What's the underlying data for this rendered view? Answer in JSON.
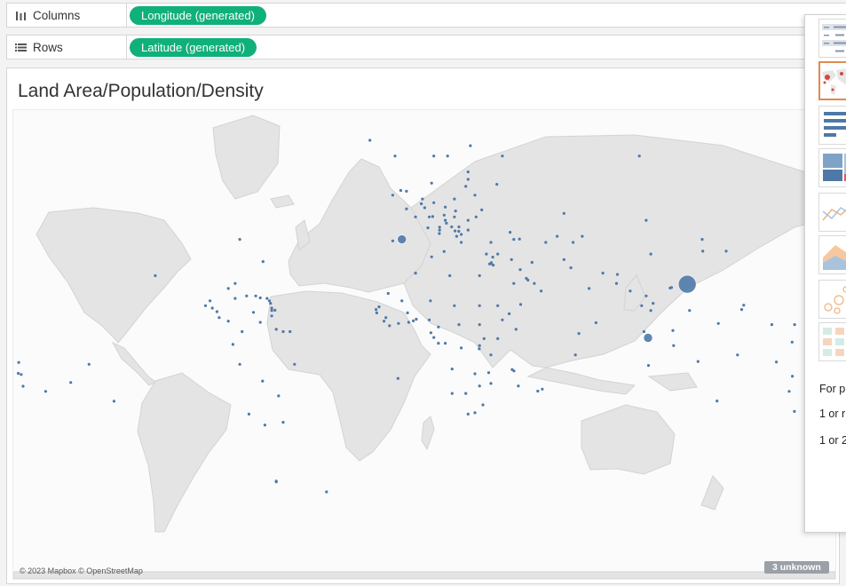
{
  "shelves": {
    "columns": {
      "label": "Columns",
      "icon": "columns-icon",
      "pill": "Longitude (generated)"
    },
    "rows": {
      "label": "Rows",
      "icon": "rows-icon",
      "pill": "Latitude (generated)"
    }
  },
  "view": {
    "title": "Land Area/Population/Density",
    "attribution": "© 2023 Mapbox © OpenStreetMap",
    "unknown_badge": "3 unknown"
  },
  "show_me": {
    "chart_types": [
      "text-table-icon",
      "symbol-map-icon",
      "bar-chart-icon",
      "treemap-icon",
      "line-chart-icon",
      "area-chart-icon",
      "scatter-plot-icon",
      "highlight-table-icon"
    ],
    "selected": "symbol-map-icon",
    "hint_line1": "For p",
    "hint_line2": "1 or r",
    "hint_line3": "1 or 2"
  },
  "colors": {
    "pill": "#10b07a",
    "mark": "#4e79a7",
    "land": "#e4e4e4",
    "selected_border": "#e0894e"
  },
  "chart_data": {
    "type": "scatter",
    "marks": [
      {
        "lon": -141,
        "lat": -10
      },
      {
        "lon": -112,
        "lat": 27
      },
      {
        "lon": -75,
        "lat": 40
      },
      {
        "lon": -64.8,
        "lat": 32.3
      },
      {
        "lon": -68,
        "lat": 19
      },
      {
        "lon": -66,
        "lat": 18.2
      },
      {
        "lon": -63,
        "lat": 18
      },
      {
        "lon": -62,
        "lat": 17
      },
      {
        "lon": -61.5,
        "lat": 16
      },
      {
        "lon": -61,
        "lat": 14
      },
      {
        "lon": -61,
        "lat": 13
      },
      {
        "lon": -59.6,
        "lat": 13.1
      },
      {
        "lon": -61,
        "lat": 10.7
      },
      {
        "lon": -69,
        "lat": 12.2
      },
      {
        "lon": -77,
        "lat": 18
      },
      {
        "lon": -80,
        "lat": 22
      },
      {
        "lon": -72,
        "lat": 19
      },
      {
        "lon": -77,
        "lat": 24
      },
      {
        "lon": -88,
        "lat": 17
      },
      {
        "lon": -90,
        "lat": 15
      },
      {
        "lon": -87,
        "lat": 14
      },
      {
        "lon": -85,
        "lat": 12.5
      },
      {
        "lon": -84,
        "lat": 10
      },
      {
        "lon": -80,
        "lat": 8.5
      },
      {
        "lon": -74,
        "lat": 4
      },
      {
        "lon": -66,
        "lat": 8
      },
      {
        "lon": -59,
        "lat": 5
      },
      {
        "lon": -56,
        "lat": 4
      },
      {
        "lon": -53,
        "lat": 4
      },
      {
        "lon": -78,
        "lat": -1.5
      },
      {
        "lon": -75,
        "lat": -10
      },
      {
        "lon": -65,
        "lat": -17
      },
      {
        "lon": -51,
        "lat": -10
      },
      {
        "lon": -58,
        "lat": -23
      },
      {
        "lon": -56,
        "lat": -33
      },
      {
        "lon": -71,
        "lat": -30
      },
      {
        "lon": -64,
        "lat": -34
      },
      {
        "lon": -59,
        "lat": -51.7
      },
      {
        "lon": -37,
        "lat": -54.3
      },
      {
        "lon": -5.7,
        "lat": -15.9
      },
      {
        "lon": -42,
        "lat": 72
      },
      {
        "lon": -18,
        "lat": 65
      },
      {
        "lon": -7,
        "lat": 62
      },
      {
        "lon": -8,
        "lat": 53
      },
      {
        "lon": -2,
        "lat": 54
      },
      {
        "lon": -2,
        "lat": 49.3
      },
      {
        "lon": -4.5,
        "lat": 54.2
      },
      {
        "lon": 2,
        "lat": 47
      },
      {
        "lon": -8,
        "lat": 39.5
      },
      {
        "lon": -4,
        "lat": 40,
        "size": "m"
      },
      {
        "lon": 5,
        "lat": 52
      },
      {
        "lon": 4.5,
        "lat": 50.7
      },
      {
        "lon": 6,
        "lat": 49.6
      },
      {
        "lon": 10,
        "lat": 51
      },
      {
        "lon": 8,
        "lat": 47
      },
      {
        "lon": 9.5,
        "lat": 47.1
      },
      {
        "lon": 7.4,
        "lat": 43.7
      },
      {
        "lon": 12.5,
        "lat": 43.9
      },
      {
        "lon": 12.4,
        "lat": 41.9
      },
      {
        "lon": 14.5,
        "lat": 35.9
      },
      {
        "lon": 14.5,
        "lat": 47.5
      },
      {
        "lon": 12.5,
        "lat": 43
      },
      {
        "lon": 9,
        "lat": 56
      },
      {
        "lon": 10,
        "lat": 62
      },
      {
        "lon": 16,
        "lat": 62
      },
      {
        "lon": 26,
        "lat": 64
      },
      {
        "lon": 25,
        "lat": 58.6
      },
      {
        "lon": 25,
        "lat": 56.9
      },
      {
        "lon": 24,
        "lat": 55.2
      },
      {
        "lon": 19,
        "lat": 52
      },
      {
        "lon": 15,
        "lat": 49.8
      },
      {
        "lon": 19.5,
        "lat": 48.7
      },
      {
        "lon": 19,
        "lat": 47
      },
      {
        "lon": 15,
        "lat": 46
      },
      {
        "lon": 15.5,
        "lat": 45.1
      },
      {
        "lon": 21,
        "lat": 44
      },
      {
        "lon": 17.8,
        "lat": 44
      },
      {
        "lon": 19.3,
        "lat": 42.7
      },
      {
        "lon": 20.9,
        "lat": 42.6
      },
      {
        "lon": 22,
        "lat": 41.6
      },
      {
        "lon": 20,
        "lat": 41
      },
      {
        "lon": 22,
        "lat": 39
      },
      {
        "lon": 25,
        "lat": 43
      },
      {
        "lon": 25,
        "lat": 46
      },
      {
        "lon": 28.5,
        "lat": 47
      },
      {
        "lon": 31,
        "lat": 49
      },
      {
        "lon": 28,
        "lat": 53
      },
      {
        "lon": 37.6,
        "lat": 55.7
      },
      {
        "lon": 40,
        "lat": 62
      },
      {
        "lon": 100,
        "lat": 62
      },
      {
        "lon": 18,
        "lat": 79
      },
      {
        "lon": -8.5,
        "lat": 71
      },
      {
        "lon": 33,
        "lat": 35
      },
      {
        "lon": 35,
        "lat": 39
      },
      {
        "lon": 38,
        "lat": 35
      },
      {
        "lon": 35.8,
        "lat": 33.9
      },
      {
        "lon": 35,
        "lat": 31.5
      },
      {
        "lon": 34.4,
        "lat": 31.4
      },
      {
        "lon": 35.2,
        "lat": 31.9
      },
      {
        "lon": 36,
        "lat": 31
      },
      {
        "lon": 44,
        "lat": 33
      },
      {
        "lon": 45,
        "lat": 40
      },
      {
        "lon": 43.4,
        "lat": 42.3
      },
      {
        "lon": 47.5,
        "lat": 40.1
      },
      {
        "lon": 53,
        "lat": 32
      },
      {
        "lon": 45,
        "lat": 24
      },
      {
        "lon": 47.8,
        "lat": 29.3
      },
      {
        "lon": 50.5,
        "lat": 26
      },
      {
        "lon": 51.2,
        "lat": 25.3
      },
      {
        "lon": 54,
        "lat": 24
      },
      {
        "lon": 57,
        "lat": 21
      },
      {
        "lon": 48,
        "lat": 15.5
      },
      {
        "lon": 59,
        "lat": 39
      },
      {
        "lon": 64,
        "lat": 41
      },
      {
        "lon": 71,
        "lat": 39
      },
      {
        "lon": 75,
        "lat": 41
      },
      {
        "lon": 67,
        "lat": 48
      },
      {
        "lon": 67,
        "lat": 33
      },
      {
        "lon": 70,
        "lat": 30
      },
      {
        "lon": 78,
        "lat": 22
      },
      {
        "lon": 84,
        "lat": 28
      },
      {
        "lon": 90.4,
        "lat": 27.5
      },
      {
        "lon": 90,
        "lat": 24
      },
      {
        "lon": 81,
        "lat": 7.8
      },
      {
        "lon": 73.5,
        "lat": 3.2
      },
      {
        "lon": 72,
        "lat": -6
      },
      {
        "lon": 96,
        "lat": 21
      },
      {
        "lon": 101,
        "lat": 15
      },
      {
        "lon": 103,
        "lat": 19
      },
      {
        "lon": 105,
        "lat": 13
      },
      {
        "lon": 106,
        "lat": 16
      },
      {
        "lon": 102,
        "lat": 4
      },
      {
        "lon": 103.8,
        "lat": 1.35,
        "size": "m"
      },
      {
        "lon": 114.7,
        "lat": 4.5
      },
      {
        "lon": 105,
        "lat": 35
      },
      {
        "lon": 114.1,
        "lat": 22.4
      },
      {
        "lon": 113.5,
        "lat": 22.2
      },
      {
        "lon": 121,
        "lat": 23.7,
        "size": "l"
      },
      {
        "lon": 103,
        "lat": 46
      },
      {
        "lon": 127.5,
        "lat": 40
      },
      {
        "lon": 127.8,
        "lat": 36
      },
      {
        "lon": 138,
        "lat": 36
      },
      {
        "lon": 122,
        "lat": 13
      },
      {
        "lon": 115,
        "lat": -2
      },
      {
        "lon": 125.7,
        "lat": -8.8
      },
      {
        "lon": 104,
        "lat": -10.5
      },
      {
        "lon": 144.8,
        "lat": 13.4
      },
      {
        "lon": 145.7,
        "lat": 15.2
      },
      {
        "lon": 134.6,
        "lat": 7.5
      },
      {
        "lon": 158,
        "lat": 7
      },
      {
        "lon": 168,
        "lat": 7
      },
      {
        "lon": 173,
        "lat": 1.4
      },
      {
        "lon": 143,
        "lat": -6
      },
      {
        "lon": 160,
        "lat": -9
      },
      {
        "lon": 166.9,
        "lat": -0.5
      },
      {
        "lon": 179,
        "lat": -8
      },
      {
        "lon": 167,
        "lat": -15
      },
      {
        "lon": 165.6,
        "lat": -21.2
      },
      {
        "lon": 178,
        "lat": -17.8
      },
      {
        "lon": -172,
        "lat": -13.8
      },
      {
        "lon": -170.7,
        "lat": -14.3
      },
      {
        "lon": -175,
        "lat": -21
      },
      {
        "lon": -169.9,
        "lat": -19.1
      },
      {
        "lon": -160,
        "lat": -21.2
      },
      {
        "lon": -149,
        "lat": -17.6
      },
      {
        "lon": -176,
        "lat": -13.3
      },
      {
        "lon": -171.8,
        "lat": -9.2
      },
      {
        "lon": -130.1,
        "lat": -25.1
      },
      {
        "lon": 134,
        "lat": -25
      },
      {
        "lon": 167.9,
        "lat": -29
      },
      {
        "lon": 174,
        "lat": -41
      },
      {
        "lon": -10,
        "lat": 20
      },
      {
        "lon": -14,
        "lat": 14.5
      },
      {
        "lon": -15.3,
        "lat": 13.4
      },
      {
        "lon": -15,
        "lat": 12
      },
      {
        "lon": -11,
        "lat": 10
      },
      {
        "lon": -11.8,
        "lat": 8.5
      },
      {
        "lon": -9.4,
        "lat": 6.5
      },
      {
        "lon": -5.5,
        "lat": 7.5
      },
      {
        "lon": -1.5,
        "lat": 12
      },
      {
        "lon": -1,
        "lat": 8
      },
      {
        "lon": 1,
        "lat": 8.6
      },
      {
        "lon": 2.3,
        "lat": 9.3
      },
      {
        "lon": 8,
        "lat": 9
      },
      {
        "lon": 8.5,
        "lat": 17
      },
      {
        "lon": -4,
        "lat": 17
      },
      {
        "lon": 2,
        "lat": 28
      },
      {
        "lon": 9,
        "lat": 34
      },
      {
        "lon": 17,
        "lat": 27
      },
      {
        "lon": 30,
        "lat": 27
      },
      {
        "lon": 30,
        "lat": 15
      },
      {
        "lon": 30,
        "lat": 7
      },
      {
        "lon": 19,
        "lat": 15
      },
      {
        "lon": 21,
        "lat": 7
      },
      {
        "lon": 12,
        "lat": 6
      },
      {
        "lon": 10,
        "lat": 1.5
      },
      {
        "lon": 8.7,
        "lat": 3.5
      },
      {
        "lon": 12,
        "lat": -1
      },
      {
        "lon": 15,
        "lat": -1
      },
      {
        "lon": 22,
        "lat": -3
      },
      {
        "lon": 30,
        "lat": -2
      },
      {
        "lon": 29.9,
        "lat": -3.4
      },
      {
        "lon": 32,
        "lat": 1
      },
      {
        "lon": 38,
        "lat": 1
      },
      {
        "lon": 40,
        "lat": 9
      },
      {
        "lon": 38,
        "lat": 15
      },
      {
        "lon": 43,
        "lat": 11.6
      },
      {
        "lon": 46,
        "lat": 5
      },
      {
        "lon": 35,
        "lat": -6
      },
      {
        "lon": 18,
        "lat": -12
      },
      {
        "lon": 28,
        "lat": -14
      },
      {
        "lon": 34,
        "lat": -13.5
      },
      {
        "lon": 35,
        "lat": -18
      },
      {
        "lon": 30,
        "lat": -19
      },
      {
        "lon": 24,
        "lat": -22
      },
      {
        "lon": 18,
        "lat": -22
      },
      {
        "lon": 25,
        "lat": -30
      },
      {
        "lon": 31.5,
        "lat": -26.5
      },
      {
        "lon": 28,
        "lat": -29.5
      },
      {
        "lon": 47,
        "lat": -19
      },
      {
        "lon": 44.3,
        "lat": -12.2
      },
      {
        "lon": 45.1,
        "lat": -12.8
      },
      {
        "lon": 55.5,
        "lat": -21.1
      },
      {
        "lon": 57.5,
        "lat": -20.3
      },
      {
        "lon": -59,
        "lat": -51.5
      }
    ],
    "xlabel": "Longitude (generated)",
    "ylabel": "Latitude (generated)"
  }
}
